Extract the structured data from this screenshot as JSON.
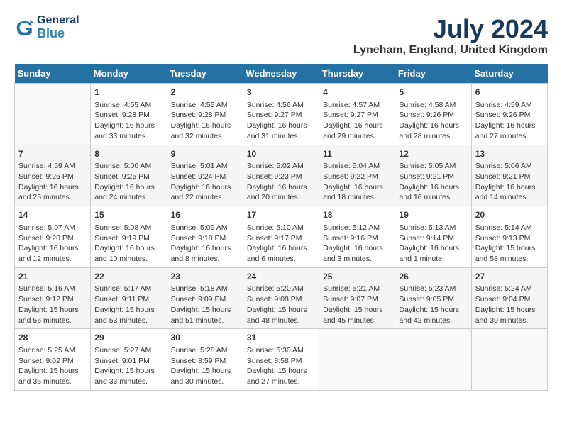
{
  "header": {
    "logo_general": "General",
    "logo_blue": "Blue",
    "title": "July 2024",
    "location": "Lyneham, England, United Kingdom"
  },
  "calendar": {
    "days_of_week": [
      "Sunday",
      "Monday",
      "Tuesday",
      "Wednesday",
      "Thursday",
      "Friday",
      "Saturday"
    ],
    "weeks": [
      [
        {
          "day": "",
          "content": ""
        },
        {
          "day": "1",
          "content": "Sunrise: 4:55 AM\nSunset: 9:28 PM\nDaylight: 16 hours and 33 minutes."
        },
        {
          "day": "2",
          "content": "Sunrise: 4:55 AM\nSunset: 9:28 PM\nDaylight: 16 hours and 32 minutes."
        },
        {
          "day": "3",
          "content": "Sunrise: 4:56 AM\nSunset: 9:27 PM\nDaylight: 16 hours and 31 minutes."
        },
        {
          "day": "4",
          "content": "Sunrise: 4:57 AM\nSunset: 9:27 PM\nDaylight: 16 hours and 29 minutes."
        },
        {
          "day": "5",
          "content": "Sunrise: 4:58 AM\nSunset: 9:26 PM\nDaylight: 16 hours and 28 minutes."
        },
        {
          "day": "6",
          "content": "Sunrise: 4:59 AM\nSunset: 9:26 PM\nDaylight: 16 hours and 27 minutes."
        }
      ],
      [
        {
          "day": "7",
          "content": "Sunrise: 4:59 AM\nSunset: 9:25 PM\nDaylight: 16 hours and 25 minutes."
        },
        {
          "day": "8",
          "content": "Sunrise: 5:00 AM\nSunset: 9:25 PM\nDaylight: 16 hours and 24 minutes."
        },
        {
          "day": "9",
          "content": "Sunrise: 5:01 AM\nSunset: 9:24 PM\nDaylight: 16 hours and 22 minutes."
        },
        {
          "day": "10",
          "content": "Sunrise: 5:02 AM\nSunset: 9:23 PM\nDaylight: 16 hours and 20 minutes."
        },
        {
          "day": "11",
          "content": "Sunrise: 5:04 AM\nSunset: 9:22 PM\nDaylight: 16 hours and 18 minutes."
        },
        {
          "day": "12",
          "content": "Sunrise: 5:05 AM\nSunset: 9:21 PM\nDaylight: 16 hours and 16 minutes."
        },
        {
          "day": "13",
          "content": "Sunrise: 5:06 AM\nSunset: 9:21 PM\nDaylight: 16 hours and 14 minutes."
        }
      ],
      [
        {
          "day": "14",
          "content": "Sunrise: 5:07 AM\nSunset: 9:20 PM\nDaylight: 16 hours and 12 minutes."
        },
        {
          "day": "15",
          "content": "Sunrise: 5:08 AM\nSunset: 9:19 PM\nDaylight: 16 hours and 10 minutes."
        },
        {
          "day": "16",
          "content": "Sunrise: 5:09 AM\nSunset: 9:18 PM\nDaylight: 16 hours and 8 minutes."
        },
        {
          "day": "17",
          "content": "Sunrise: 5:10 AM\nSunset: 9:17 PM\nDaylight: 16 hours and 6 minutes."
        },
        {
          "day": "18",
          "content": "Sunrise: 5:12 AM\nSunset: 9:16 PM\nDaylight: 16 hours and 3 minutes."
        },
        {
          "day": "19",
          "content": "Sunrise: 5:13 AM\nSunset: 9:14 PM\nDaylight: 16 hours and 1 minute."
        },
        {
          "day": "20",
          "content": "Sunrise: 5:14 AM\nSunset: 9:13 PM\nDaylight: 15 hours and 58 minutes."
        }
      ],
      [
        {
          "day": "21",
          "content": "Sunrise: 5:16 AM\nSunset: 9:12 PM\nDaylight: 15 hours and 56 minutes."
        },
        {
          "day": "22",
          "content": "Sunrise: 5:17 AM\nSunset: 9:11 PM\nDaylight: 15 hours and 53 minutes."
        },
        {
          "day": "23",
          "content": "Sunrise: 5:18 AM\nSunset: 9:09 PM\nDaylight: 15 hours and 51 minutes."
        },
        {
          "day": "24",
          "content": "Sunrise: 5:20 AM\nSunset: 9:08 PM\nDaylight: 15 hours and 48 minutes."
        },
        {
          "day": "25",
          "content": "Sunrise: 5:21 AM\nSunset: 9:07 PM\nDaylight: 15 hours and 45 minutes."
        },
        {
          "day": "26",
          "content": "Sunrise: 5:23 AM\nSunset: 9:05 PM\nDaylight: 15 hours and 42 minutes."
        },
        {
          "day": "27",
          "content": "Sunrise: 5:24 AM\nSunset: 9:04 PM\nDaylight: 15 hours and 39 minutes."
        }
      ],
      [
        {
          "day": "28",
          "content": "Sunrise: 5:25 AM\nSunset: 9:02 PM\nDaylight: 15 hours and 36 minutes."
        },
        {
          "day": "29",
          "content": "Sunrise: 5:27 AM\nSunset: 9:01 PM\nDaylight: 15 hours and 33 minutes."
        },
        {
          "day": "30",
          "content": "Sunrise: 5:28 AM\nSunset: 8:59 PM\nDaylight: 15 hours and 30 minutes."
        },
        {
          "day": "31",
          "content": "Sunrise: 5:30 AM\nSunset: 8:58 PM\nDaylight: 15 hours and 27 minutes."
        },
        {
          "day": "",
          "content": ""
        },
        {
          "day": "",
          "content": ""
        },
        {
          "day": "",
          "content": ""
        }
      ]
    ]
  }
}
